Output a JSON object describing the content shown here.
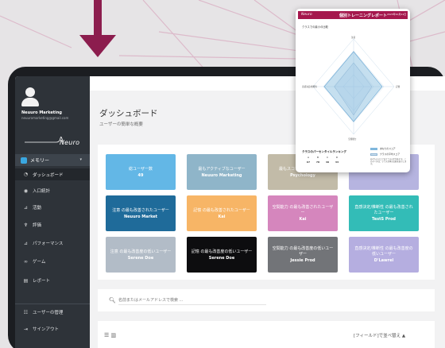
{
  "colors": {
    "accent": "#8c1d4e",
    "sidebar": "#2e3339",
    "report_header": "#a5184d"
  },
  "profile": {
    "name": "Neuuro Marketing",
    "email": "neuuromarketing@gmail.com"
  },
  "logo": "Neuro",
  "sidebar": {
    "menu_label": "メモリー",
    "menu_chevron": "▾",
    "items": [
      {
        "icon": "dashboard-icon",
        "glyph": "◔",
        "label": "ダッシュボード"
      },
      {
        "icon": "chart-icon",
        "glyph": "◉",
        "label": "入口統計"
      },
      {
        "icon": "bar-chart-icon",
        "glyph": "⊿",
        "label": "活動"
      },
      {
        "icon": "trophy-icon",
        "glyph": "♆",
        "label": "評価"
      },
      {
        "icon": "line-chart-icon",
        "glyph": "⊿",
        "label": "パフォーマンス"
      },
      {
        "icon": "gamepad-icon",
        "glyph": "∞",
        "label": "ゲーム"
      },
      {
        "icon": "document-icon",
        "glyph": "▤",
        "label": "レポート"
      }
    ],
    "bottom": [
      {
        "icon": "users-icon",
        "glyph": "☷",
        "label": "ユーザーの管理"
      },
      {
        "icon": "logout-icon",
        "glyph": "⇥",
        "label": "サインアウト"
      }
    ]
  },
  "page": {
    "title": "ダッシュボード",
    "subtitle": "ユーザーの簡単な概要"
  },
  "cards": [
    {
      "title": "総ユーザー数",
      "value": "49",
      "bg": "#63b7e6",
      "fg": "#ffffff"
    },
    {
      "title": "最もアクティブなユーザー",
      "value": "Neuuro Marketing",
      "bg": "#8fb5c9",
      "fg": "#ffffff"
    },
    {
      "title": "最もスコアの高いユーザー",
      "value": "Psychology",
      "bg": "#c2bba8",
      "fg": "#ffffff"
    },
    {
      "title": "",
      "value": "",
      "bg": "#b6b4e0",
      "fg": "#ffffff"
    },
    {
      "title": "注意 の最も改善されたユーザー",
      "value": "Neuuro Market",
      "bg": "#1f6b9a",
      "fg": "#ffffff"
    },
    {
      "title": "記憶 の最も改善されたユーザー",
      "value": "Kai",
      "bg": "#f7b566",
      "fg": "#ffffff"
    },
    {
      "title": "空間能力 の最も改善されたユーザー",
      "value": "Kai",
      "bg": "#d586bd",
      "fg": "#ffffff"
    },
    {
      "title": "直感決定/推断性 の最も改善されたユーザー",
      "value": "TestS Prod",
      "bg": "#33bcb7",
      "fg": "#ffffff"
    },
    {
      "title": "注意 の最も改善度の低いユーザー",
      "value": "Serene Doe",
      "bg": "#b2bcc7",
      "fg": "#ffffff"
    },
    {
      "title": "記憶 の最も改善度の低いユーザー",
      "value": "Serene Doe",
      "bg": "#0d0d0f",
      "fg": "#ffffff"
    },
    {
      "title": "空間能力 の最も改善度の低いユーザー",
      "value": "Jessie Prod",
      "bg": "#727478",
      "fg": "#ffffff"
    },
    {
      "title": "直感決定/推断性 の最も改善度の低いユーザー",
      "value": "D'Lawrel",
      "bg": "#b5aee0",
      "fg": "#ffffff"
    }
  ],
  "search": {
    "placeholder": "名前またはメールアドレスで検索 ..."
  },
  "list_controls": {
    "view_toggle": "☰ ▥",
    "sort_label": "[フィールド]で並べ替え ▲"
  },
  "report": {
    "logo": "Neuro",
    "title": "個別トレーニングレポート",
    "date": "2023年10月11日",
    "section_title": "クラスでの最小の比較",
    "legend": [
      "あなたのスコア",
      "クラスの平均スコア"
    ],
    "ranking_title": "クラスのパーセンタイルランキング",
    "ranking_headers": [
      "A",
      "B",
      "C",
      "D"
    ],
    "ranking_values": [
      "67",
      "78",
      "49",
      "33"
    ],
    "note": "あなたのスコアはクラスの平均を示す。このデータは、クラス全体の比較を表示します。",
    "axis_labels": [
      "注意",
      "直感決定/推断性",
      "記憶",
      "空間能力"
    ]
  }
}
